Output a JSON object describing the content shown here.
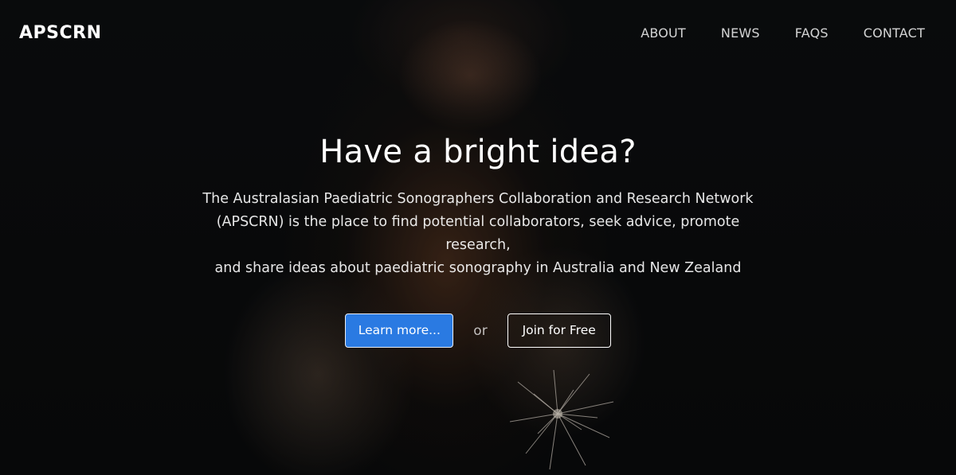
{
  "brand": {
    "name": "APSCRN"
  },
  "nav": {
    "items": [
      {
        "label": "ABOUT"
      },
      {
        "label": "NEWS"
      },
      {
        "label": "FAQS"
      },
      {
        "label": "CONTACT"
      }
    ]
  },
  "hero": {
    "title": "Have a bright idea?",
    "lines": [
      "The Australasian Paediatric Sonographers Collaboration and Research Network",
      "(APSCRN) is the place to find potential collaborators, seek advice, promote research,",
      "and share ideas about paediatric sonography in Australia and New Zealand"
    ],
    "primary_button": "Learn more...",
    "separator": "or",
    "secondary_button": "Join for Free"
  },
  "colors": {
    "primary_button": "#2a7ae2",
    "background": "#0a0b0d",
    "text": "#ffffff"
  }
}
